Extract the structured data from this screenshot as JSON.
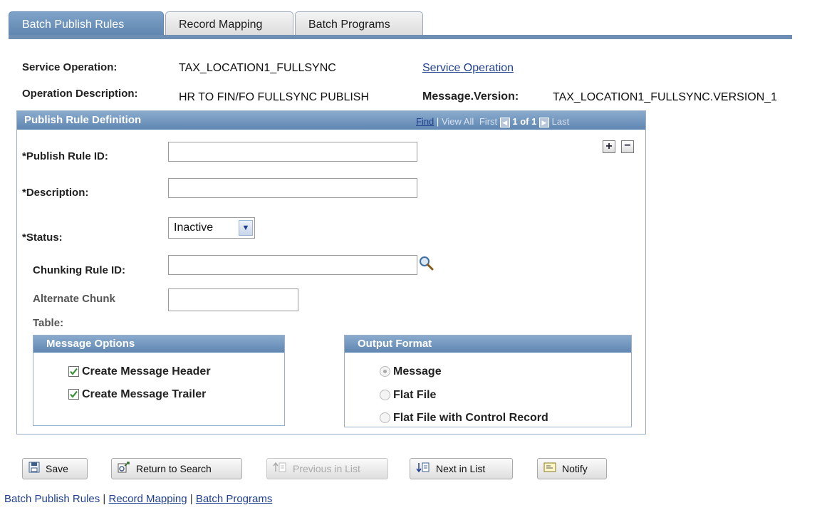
{
  "tabs": [
    {
      "label": "Batch Publish Rules"
    },
    {
      "label": "Record Mapping"
    },
    {
      "label": "Batch Programs"
    }
  ],
  "header": {
    "service_operation_label": "Service Operation:",
    "service_operation_value": "TAX_LOCATION1_FULLSYNC",
    "service_operation_link": "Service Operation",
    "operation_description_label": "Operation Description:",
    "operation_description_value": "HR TO FIN/FO FULLSYNC PUBLISH",
    "message_version_label": "Message.Version:",
    "message_version_value": "TAX_LOCATION1_FULLSYNC.VERSION_1"
  },
  "publish_rule": {
    "title": "Publish Rule Definition",
    "nav": {
      "find": "Find",
      "sep": "|",
      "view_all": "View All",
      "first": "First",
      "count": "1 of 1",
      "last": "Last"
    },
    "fields": {
      "publish_rule_id_label": "*Publish Rule ID:",
      "publish_rule_id_value": "",
      "description_label": "*Description:",
      "description_value": "",
      "status_label": "*Status:",
      "status_value": "Inactive",
      "chunking_rule_id_label": "Chunking Rule ID:",
      "chunking_rule_id_value": "",
      "alternate_chunk_label_1": "Alternate Chunk",
      "alternate_chunk_label_2": "Table:",
      "alternate_chunk_value": ""
    },
    "message_options": {
      "title": "Message Options",
      "items": [
        {
          "label": "Create Message Header",
          "checked": true
        },
        {
          "label": "Create Message Trailer",
          "checked": true
        }
      ]
    },
    "output_format": {
      "title": "Output Format",
      "options": [
        {
          "label": "Message",
          "selected": true,
          "disabled": true
        },
        {
          "label": "Flat File",
          "selected": false,
          "disabled": false
        },
        {
          "label": "Flat File with Control Record",
          "selected": false,
          "disabled": false
        }
      ]
    }
  },
  "buttons": {
    "save": "Save",
    "return_to_search": "Return to Search",
    "previous_in_list": "Previous in List",
    "next_in_list": "Next in List",
    "notify": "Notify"
  },
  "footer_links": {
    "batch_publish_rules": "Batch Publish Rules",
    "sep": "|",
    "record_mapping": "Record Mapping",
    "batch_programs": "Batch Programs"
  },
  "colors": {
    "accent": "#6c8fb3",
    "link": "#1f3f8f",
    "check": "#2e8b2e"
  }
}
